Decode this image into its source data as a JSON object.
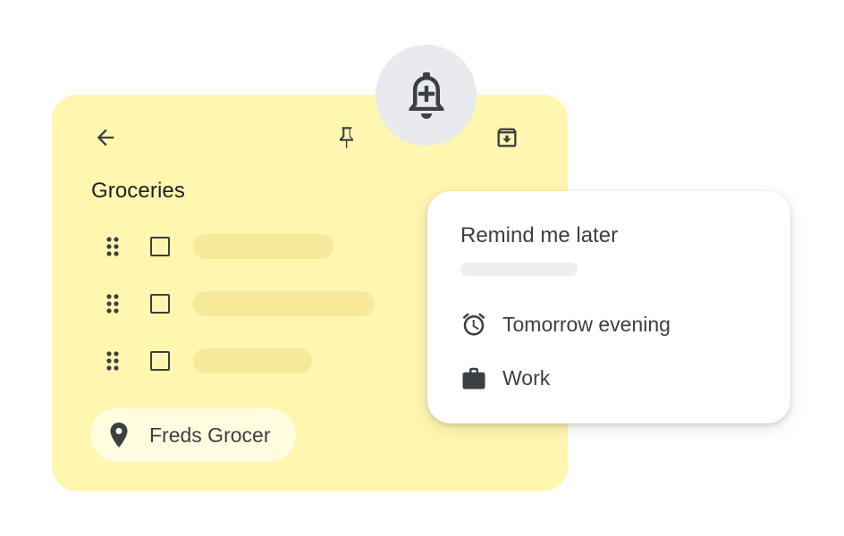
{
  "note": {
    "title": "Groceries",
    "items": [
      {
        "checked": false
      },
      {
        "checked": false
      },
      {
        "checked": false
      }
    ],
    "location": {
      "label": "Freds Grocer",
      "icon": "location-pin-icon"
    },
    "toolbar": {
      "back_icon": "arrow-back-icon",
      "pin_icon": "pin-icon",
      "archive_icon": "archive-icon"
    }
  },
  "reminder_button": {
    "icon": "bell-plus-icon"
  },
  "reminder_menu": {
    "title": "Remind me later",
    "options": [
      {
        "label": "Tomorrow evening",
        "icon": "alarm-clock-icon"
      },
      {
        "label": "Work",
        "icon": "briefcase-icon"
      }
    ]
  },
  "colors": {
    "note_background": "#FFF6B0",
    "placeholder": "#F6E99A",
    "chip_background": "#FFFCE0",
    "bell_background": "#E8EAED",
    "text": "#3c4043"
  }
}
